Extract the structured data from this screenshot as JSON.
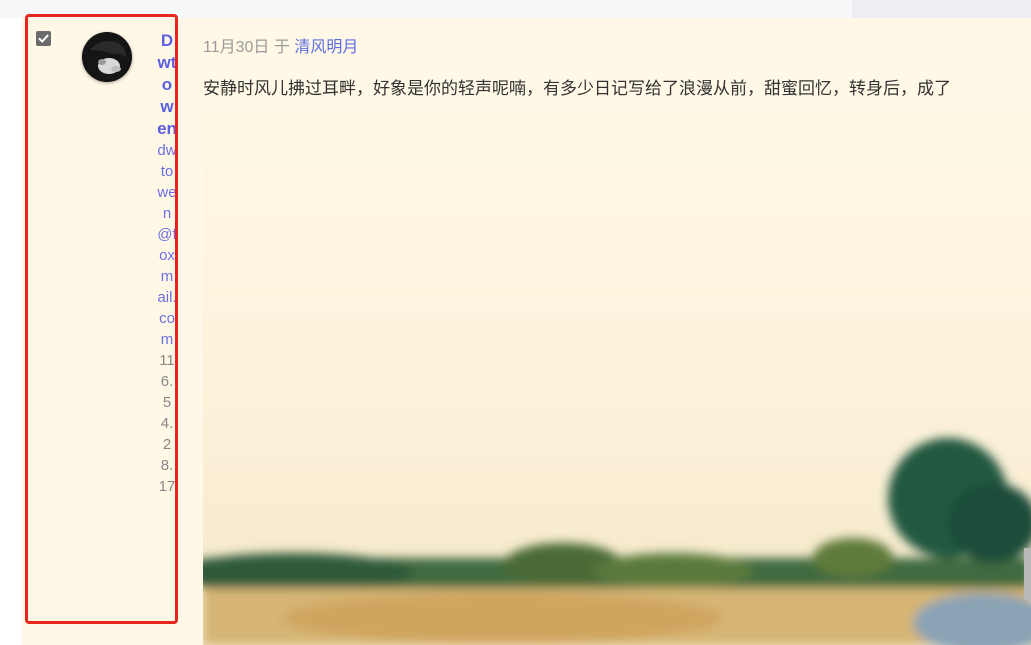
{
  "comment": {
    "selected": true,
    "author": {
      "name": "Dwtowen",
      "email": "dwtowen@foxmail.com",
      "ip": "116.54.28.17"
    },
    "date": "11月30日",
    "in_label": "于",
    "post_title": "清风明月",
    "text": "安静时风儿拂过耳畔，好象是你的轻声呢喃，有多少日记写给了浪漫从前，甜蜜回忆，转身后，成了"
  },
  "colors": {
    "row_background": "#fff8e6",
    "highlight_border": "#e8261e",
    "link": "#5b6ee0"
  }
}
